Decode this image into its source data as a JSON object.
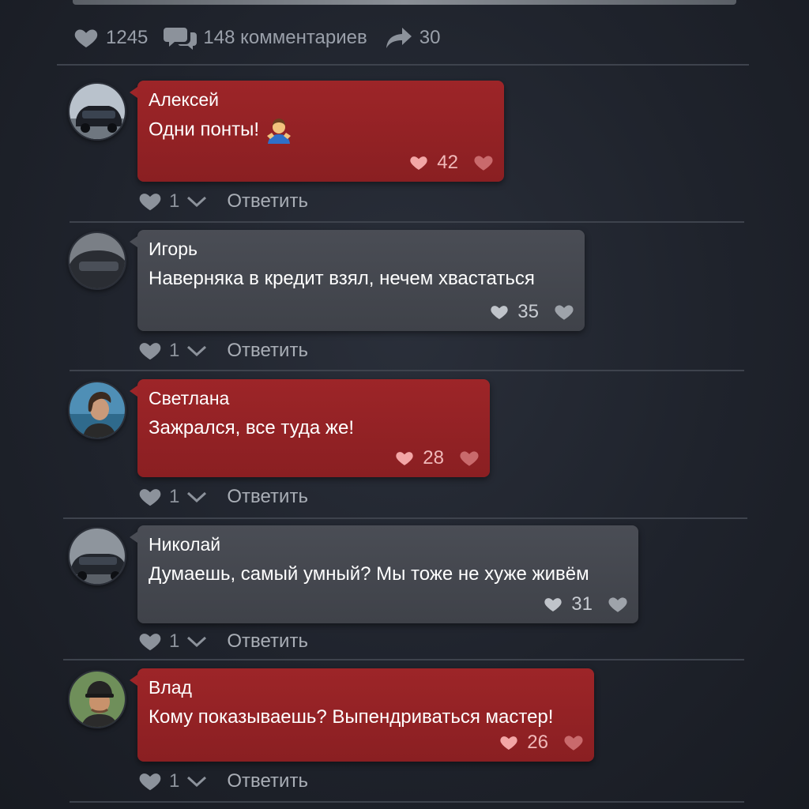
{
  "post": {
    "likes": "1245",
    "comments": "148 комментариев",
    "shares": "30"
  },
  "comments": [
    {
      "author": "Алексей",
      "text": "Одни понты!",
      "likes": "42",
      "reactions": "1",
      "reply": "Ответить"
    },
    {
      "author": "Игорь",
      "text": "Наверняка в кредит взял, нечем хвастаться",
      "likes": "35",
      "reactions": "1",
      "reply": "Ответить"
    },
    {
      "author": "Светлана",
      "text": "Зажрался, все туда же!",
      "likes": "28",
      "reactions": "1",
      "reply": "Ответить"
    },
    {
      "author": "Николай",
      "text": "Думаешь, самый умный? Мы тоже не хуже живём",
      "likes": "31",
      "reactions": "1",
      "reply": "Ответить"
    },
    {
      "author": "Влад",
      "text": "Кому показываешь? Выпендриваться мастер!",
      "likes": "26",
      "reactions": "1",
      "reply": "Ответить"
    }
  ],
  "colors": {
    "bubble_red": "#9d2528",
    "bubble_gray": "#4a4d55",
    "background": "#1f232c"
  }
}
